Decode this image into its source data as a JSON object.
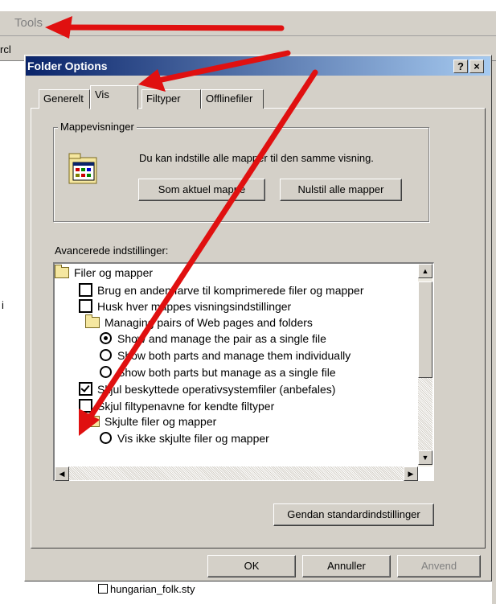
{
  "background": {
    "menu_tools": "Tools",
    "toolbar_fragment": "rcl",
    "left_fragment": "i",
    "bottom_file": "hungarian_folk.sty"
  },
  "dialog": {
    "title": "Folder Options",
    "help_label": "?",
    "close_label": "×",
    "tabs": [
      {
        "label": "Generelt",
        "active": false
      },
      {
        "label": "Vis",
        "active": true
      },
      {
        "label": "Filtyper",
        "active": false
      },
      {
        "label": "Offlinefiler",
        "active": false
      }
    ],
    "group": {
      "title": "Mappevisninger",
      "description": "Du kan indstille alle mapper til den samme visning.",
      "btn_current": "Som aktuel mappe",
      "btn_reset": "Nulstil alle mapper"
    },
    "advanced_label": "Avancerede indstillinger:",
    "tree": [
      {
        "type": "folder",
        "label": "Filer og mapper",
        "indent": 0
      },
      {
        "type": "checkbox",
        "label": "Brug en anden farve til komprimerede filer og mapper",
        "checked": false,
        "indent": 1
      },
      {
        "type": "checkbox",
        "label": "Husk hver mappes visningsindstillinger",
        "checked": false,
        "indent": 1
      },
      {
        "type": "folder",
        "label": "Managing pairs of Web pages and folders",
        "indent": 1
      },
      {
        "type": "radio",
        "label": "Show and manage the pair as a single file",
        "checked": true,
        "indent": 2
      },
      {
        "type": "radio",
        "label": "Show both parts and manage them individually",
        "checked": false,
        "indent": 2
      },
      {
        "type": "radio",
        "label": "Show both parts but manage as a single file",
        "checked": false,
        "indent": 2
      },
      {
        "type": "checkbox",
        "label": "Skjul beskyttede operativsystemfiler (anbefales)",
        "checked": true,
        "indent": 1
      },
      {
        "type": "checkbox",
        "label": "Skjul filtypenavne for kendte filtyper",
        "checked": false,
        "indent": 1
      },
      {
        "type": "folder",
        "label": "Skjulte filer og mapper",
        "indent": 1
      },
      {
        "type": "radio",
        "label": "Vis ikke skjulte filer og mapper",
        "checked": false,
        "indent": 2
      }
    ],
    "btn_restore": "Gendan standardindstillinger",
    "btn_ok": "OK",
    "btn_cancel": "Annuller",
    "btn_apply": "Anvend"
  },
  "colors": {
    "annotation_arrow": "#e01010",
    "title_gradient_start": "#0a246a",
    "title_gradient_end": "#a6caf0"
  }
}
